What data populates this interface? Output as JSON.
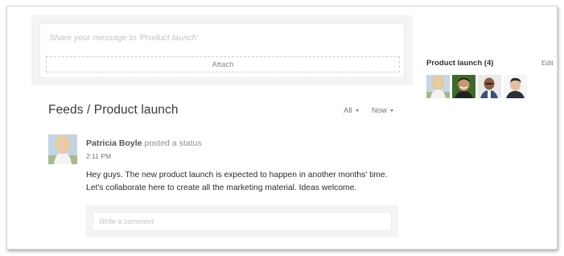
{
  "composer": {
    "placeholder": "Share your message to 'Product launch'",
    "attach_label": "Attach"
  },
  "feeds": {
    "title": "Feeds / Product launch",
    "filter_all": "All",
    "filter_now": "Now"
  },
  "post": {
    "author": "Patricia Boyle",
    "action": "posted a status",
    "time": "2:11 PM",
    "body_lines": [
      "Hey guys. The new product launch is expected to happen in another months' time.",
      "Let's collaborate here to create all the marketing material. Ideas welcome."
    ],
    "comment_placeholder": "Write a comment"
  },
  "group": {
    "title": "Product launch (4)",
    "edit_label": "Edit",
    "members": [
      {
        "icon": "member-avatar-woman-blonde"
      },
      {
        "icon": "member-avatar-man-smiling"
      },
      {
        "icon": "member-avatar-man-bald"
      },
      {
        "icon": "member-avatar-man-dark-hair"
      }
    ]
  }
}
